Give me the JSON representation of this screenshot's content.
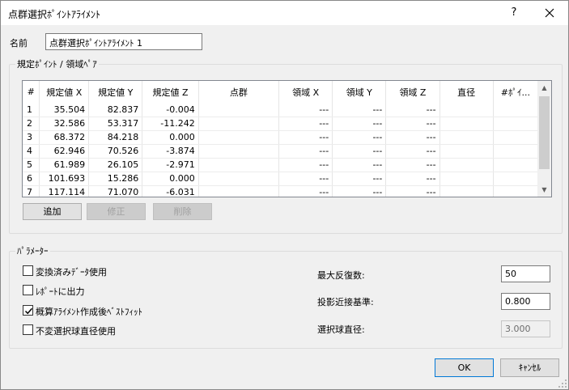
{
  "window": {
    "title": "点群選択ﾎﾟｲﾝﾄｱﾗｲﾒﾝﾄ",
    "help_label": "?"
  },
  "name": {
    "label": "名前",
    "value": "点群選択ﾎﾟｲﾝﾄｱﾗｲﾒﾝﾄ 1"
  },
  "points_group": {
    "title": "規定ﾎﾟｲﾝﾄ / 領域ﾍﾟｱ",
    "columns": [
      "#",
      "規定値 X",
      "規定値 Y",
      "規定値 Z",
      "点群",
      "領域 X",
      "領域 Y",
      "領域 Z",
      "直径",
      "#ﾎﾟｲ..."
    ],
    "rows": [
      [
        "1",
        "35.504",
        "82.837",
        "-0.004",
        "",
        "---",
        "---",
        "---",
        "",
        ""
      ],
      [
        "2",
        "32.586",
        "53.317",
        "-11.242",
        "",
        "---",
        "---",
        "---",
        "",
        ""
      ],
      [
        "3",
        "68.372",
        "84.218",
        "0.000",
        "",
        "---",
        "---",
        "---",
        "",
        ""
      ],
      [
        "4",
        "62.946",
        "70.526",
        "-3.874",
        "",
        "---",
        "---",
        "---",
        "",
        ""
      ],
      [
        "5",
        "61.989",
        "26.105",
        "-2.971",
        "",
        "---",
        "---",
        "---",
        "",
        ""
      ],
      [
        "6",
        "101.693",
        "15.286",
        "0.000",
        "",
        "---",
        "---",
        "---",
        "",
        ""
      ],
      [
        "7",
        "117.114",
        "71.070",
        "-6.031",
        "",
        "---",
        "---",
        "---",
        "",
        ""
      ]
    ],
    "buttons": {
      "add": "追加",
      "edit": "修正",
      "delete": "削除"
    }
  },
  "params": {
    "title": "ﾊﾟﾗﾒｰﾀｰ",
    "checkboxes": [
      {
        "label": "変換済みﾃﾞｰﾀ使用",
        "checked": false
      },
      {
        "label": "ﾚﾎﾟｰﾄに出力",
        "checked": false
      },
      {
        "label": "概算ｱﾗｲﾒﾝﾄ作成後ﾍﾞｽﾄﾌｨｯﾄ",
        "checked": true
      },
      {
        "label": "不変選択球直径使用",
        "checked": false
      }
    ],
    "max_iterations": {
      "label": "最大反復数:",
      "value": "50"
    },
    "projection_tolerance": {
      "label": "投影近接基準:",
      "value": "0.800"
    },
    "sphere_diameter": {
      "label": "選択球直径:",
      "value": "3.000"
    }
  },
  "footer": {
    "ok": "OK",
    "cancel": "ｷｬﾝｾﾙ"
  }
}
